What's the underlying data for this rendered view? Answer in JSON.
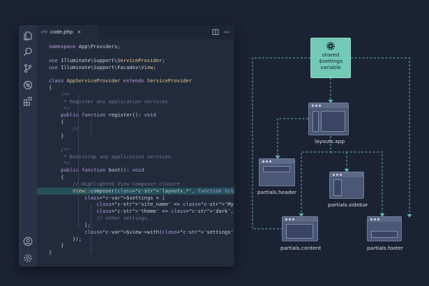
{
  "editor": {
    "tab_icon": "php",
    "tab_label": "code.php",
    "tab_close": "×",
    "activity_icons": [
      "files-icon",
      "search-icon",
      "source-control-icon",
      "debug-icon",
      "extensions-icon",
      "account-icon",
      "settings-icon"
    ],
    "toolbar_icons": [
      "split-editor-icon",
      "more-actions-icon"
    ],
    "lines": [
      "namespace App\\Providers;",
      "",
      "use Illuminate\\Support\\ServiceProvider;",
      "use Illuminate\\Support\\Facades\\View;",
      "",
      "class AppServiceProvider extends ServiceProvider",
      "{",
      "    /**",
      "     * Register any application services.",
      "     */",
      "    public function register(): void",
      "    {",
      "        //",
      "    }",
      "",
      "    /**",
      "     * Bootstrap any application services.",
      "     */",
      "    public function boot(): void",
      "    {",
      "        // Highlighted View Composer closure",
      "        View::composer('layouts.*', function ($view) {",
      "            $settings = [",
      "                'site_name' => 'My App',",
      "                'theme' => 'dark',",
      "                // other settings...",
      "            ];",
      "            $view->with('settings', $settings);",
      "        });",
      "    }",
      "}"
    ],
    "highlighted_line": 21
  },
  "diagram": {
    "shared": {
      "line1": "shared",
      "line2": "$settings",
      "line3": "variable",
      "icon": "gear-icon",
      "color": "#72c9b5"
    },
    "nodes": {
      "layouts_app": "layouts.app",
      "partials_header": "partials.header",
      "partials_sidebar": "partials.sidebar",
      "partials_content": "partials.content",
      "partials_footer": "partials.footer"
    },
    "connector_color": "#5fb8b2",
    "background": "#1b2233"
  }
}
